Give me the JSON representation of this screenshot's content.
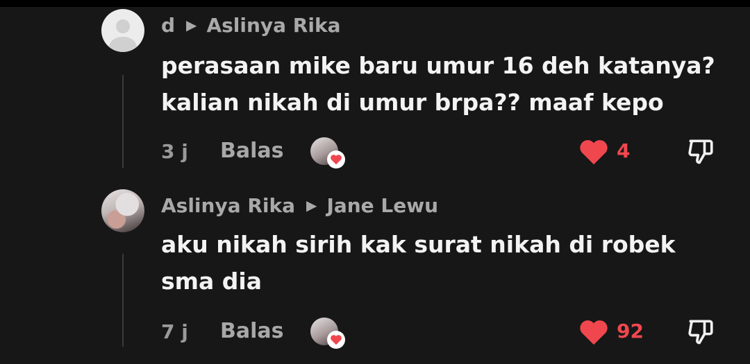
{
  "comments": [
    {
      "author": "d",
      "reply_to": "Aslinya Rika",
      "text_lines": [
        "perasaan mike baru umur 16 deh katanya?",
        "kalian nikah di umur brpa?? maaf kepo"
      ],
      "time": "3 j",
      "reply_label": "Balas",
      "likes": "4",
      "liked": true,
      "avatar": "default-avatar",
      "icons": [
        "reply-arrow-icon",
        "heart-icon",
        "thumbs-down-icon"
      ]
    },
    {
      "author": "Aslinya Rika",
      "reply_to": "Jane Lewu",
      "text_lines": [
        "aku nikah sirih kak surat nikah di robek",
        "sma dia"
      ],
      "time": "7 j",
      "reply_label": "Balas",
      "likes": "92",
      "liked": true,
      "avatar": "photo-avatar",
      "icons": [
        "reply-arrow-icon",
        "heart-icon",
        "thumbs-down-icon"
      ]
    }
  ],
  "colors": {
    "background": "#171717",
    "like": "#f0474f",
    "text": "#f3f3f3",
    "muted": "#a9a9a9"
  }
}
